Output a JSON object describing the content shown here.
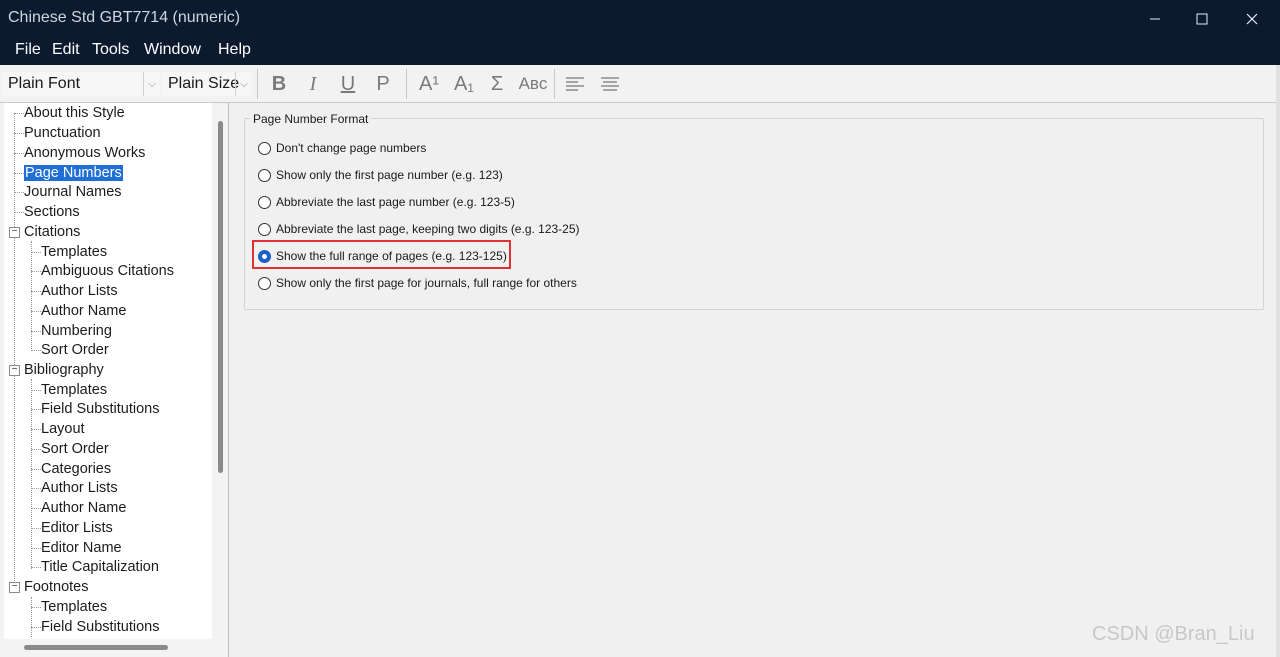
{
  "window": {
    "title": "Chinese Std GBT7714 (numeric)"
  },
  "menu": [
    "File",
    "Edit",
    "Tools",
    "Window",
    "Help"
  ],
  "toolbar": {
    "font_value": "Plain Font",
    "size_value": "Plain Size",
    "format_buttons": [
      {
        "glyph": "B",
        "name": "bold"
      },
      {
        "glyph": "I",
        "name": "italic"
      },
      {
        "glyph": "U",
        "name": "underline"
      },
      {
        "glyph": "P",
        "name": "plain"
      },
      {
        "glyph": "A¹",
        "name": "superscript"
      },
      {
        "glyph": "A₁",
        "name": "subscript"
      },
      {
        "glyph": "Σ",
        "name": "symbol"
      },
      {
        "glyph": "Aʙᴄ",
        "name": "small-caps"
      }
    ]
  },
  "tree": {
    "items": [
      {
        "label": "About this Style"
      },
      {
        "label": "Punctuation"
      },
      {
        "label": "Anonymous Works"
      },
      {
        "label": "Page Numbers",
        "selected": true
      },
      {
        "label": "Journal Names"
      },
      {
        "label": "Sections"
      },
      {
        "label": "Citations"
      },
      {
        "label": "Templates"
      },
      {
        "label": "Ambiguous Citations"
      },
      {
        "label": "Author Lists"
      },
      {
        "label": "Author Name"
      },
      {
        "label": "Numbering"
      },
      {
        "label": "Sort Order"
      },
      {
        "label": "Bibliography"
      },
      {
        "label": "Templates"
      },
      {
        "label": "Field Substitutions"
      },
      {
        "label": "Layout"
      },
      {
        "label": "Sort Order"
      },
      {
        "label": "Categories"
      },
      {
        "label": "Author Lists"
      },
      {
        "label": "Author Name"
      },
      {
        "label": "Editor Lists"
      },
      {
        "label": "Editor Name"
      },
      {
        "label": "Title Capitalization"
      },
      {
        "label": "Footnotes"
      },
      {
        "label": "Templates"
      },
      {
        "label": "Field Substitutions"
      }
    ]
  },
  "page_number_format": {
    "group_title": "Page Number Format",
    "options": [
      {
        "label": "Don't change page numbers",
        "checked": false
      },
      {
        "label": "Show only the first page number (e.g. 123)",
        "checked": false
      },
      {
        "label": "Abbreviate the last page number (e.g. 123-5)",
        "checked": false
      },
      {
        "label": "Abbreviate the last page, keeping two digits (e.g. 123-25)",
        "checked": false
      },
      {
        "label": "Show the full range of pages (e.g. 123-125)",
        "checked": true
      },
      {
        "label": "Show only the first page for journals, full range for others",
        "checked": false
      }
    ]
  },
  "watermark": "CSDN @Bran_Liu"
}
